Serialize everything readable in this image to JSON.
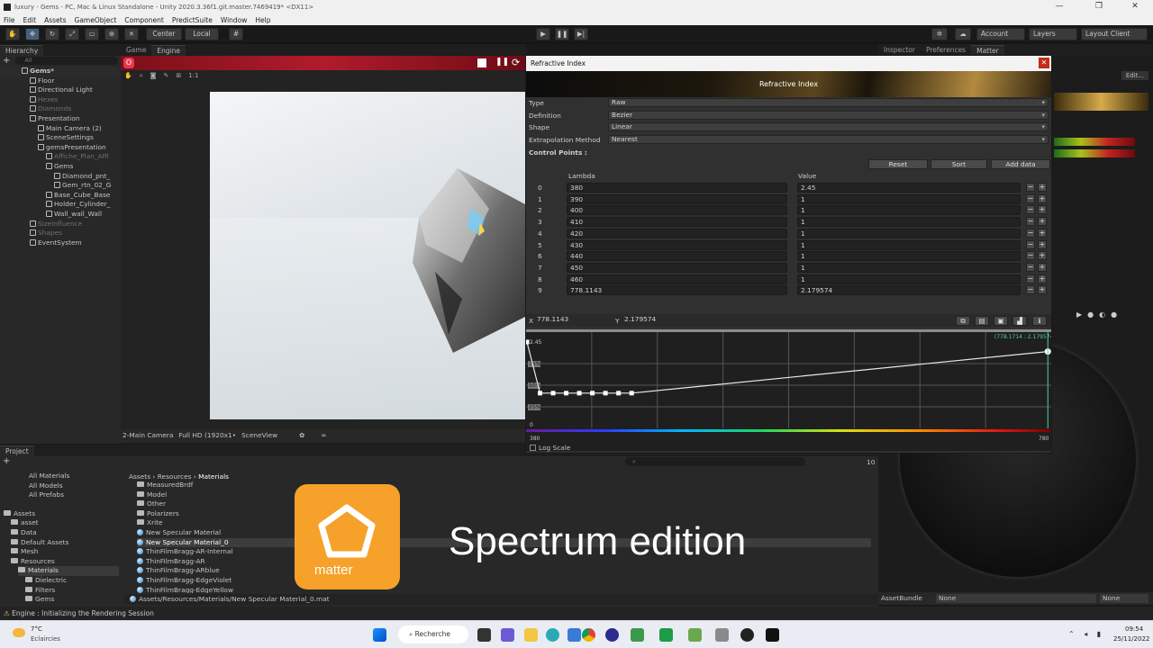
{
  "window": {
    "title": "luxury - Gems - PC, Mac & Linux Standalone - Unity 2020.3.36f1.git.master.7469419* <DX11>"
  },
  "menu": [
    "File",
    "Edit",
    "Assets",
    "GameObject",
    "Component",
    "PredictSuite",
    "Window",
    "Help"
  ],
  "toolbar": {
    "pivot": "Center",
    "space": "Local",
    "account": "Account",
    "layers": "Layers",
    "layout": "Layout Client"
  },
  "hierarchy": {
    "tab": "Hierarchy",
    "search_placeholder": "All",
    "items": [
      {
        "label": "Gems*",
        "indent": 0,
        "style": "scene"
      },
      {
        "label": "Floor",
        "indent": 1
      },
      {
        "label": "Directional Light",
        "indent": 1
      },
      {
        "label": "Hexes",
        "indent": 1,
        "style": "dim"
      },
      {
        "label": "Diamonds",
        "indent": 1,
        "style": "dim"
      },
      {
        "label": "Presentation",
        "indent": 1
      },
      {
        "label": "Main Camera (2)",
        "indent": 2
      },
      {
        "label": "SceneSettings",
        "indent": 2
      },
      {
        "label": "gemsPresentation",
        "indent": 2
      },
      {
        "label": "Affiche_Plan_Affi",
        "indent": 3,
        "style": "dim"
      },
      {
        "label": "Gems",
        "indent": 3
      },
      {
        "label": "Diamond_pnt_",
        "indent": 4
      },
      {
        "label": "Gem_rtn_02_G",
        "indent": 4
      },
      {
        "label": "Base_Cube_Base",
        "indent": 3
      },
      {
        "label": "Holder_Cylinder_",
        "indent": 3
      },
      {
        "label": "Wall_wall_Wall",
        "indent": 3
      },
      {
        "label": "SizeInfluence",
        "indent": 1,
        "style": "dim"
      },
      {
        "label": "Shapes",
        "indent": 1,
        "style": "dim"
      },
      {
        "label": "EventSystem",
        "indent": 1
      }
    ]
  },
  "game": {
    "tabs": [
      "Game",
      "Engine"
    ],
    "display": "2-Main Camera",
    "resolution": "Full HD (1920x1•",
    "view": "SceneView",
    "scale_label": "1:1"
  },
  "inspector_tabs": [
    "Inspector",
    "Preferences",
    "Matter"
  ],
  "inspector_buttons": [
    "Edit..."
  ],
  "dialog": {
    "title": "Refractive Index",
    "banner": "Refractive Index",
    "properties": [
      {
        "label": "Type",
        "value": "Raw"
      },
      {
        "label": "Definition",
        "value": "Bezier"
      },
      {
        "label": "Shape",
        "value": "Linear"
      },
      {
        "label": "Extrapolation Method",
        "value": "Nearest"
      }
    ],
    "control_points_label": "Control Points :",
    "buttons": [
      "Reset",
      "Sort",
      "Add data"
    ],
    "col_lambda": "Lambda",
    "col_value": "Value",
    "rows": [
      [
        "0",
        "380",
        "2.45"
      ],
      [
        "1",
        "390",
        "1"
      ],
      [
        "2",
        "400",
        "1"
      ],
      [
        "3",
        "410",
        "1"
      ],
      [
        "4",
        "420",
        "1"
      ],
      [
        "5",
        "430",
        "1"
      ],
      [
        "6",
        "440",
        "1"
      ],
      [
        "7",
        "450",
        "1"
      ],
      [
        "8",
        "460",
        "1"
      ],
      [
        "9",
        "778.1143",
        "2.179574"
      ]
    ],
    "cursor": {
      "x_label": "X",
      "x": "778.1143",
      "y_label": "Y",
      "y": "2.179574"
    },
    "graph": {
      "y_max_label": "2.45",
      "y_min_label": "0",
      "x_min": "380",
      "x_max": "780",
      "point_label": "(778.1714 : 2.179574)",
      "pct_labels": [
        "75%",
        "50%",
        "25%"
      ]
    },
    "log_scale": "Log Scale"
  },
  "project": {
    "tab": "Project",
    "favorites": [
      "All Materials",
      "All Models",
      "All Prefabs"
    ],
    "assets_root": "Assets",
    "tree": [
      "asset",
      "Data",
      "Default Assets",
      "Mesh",
      "Resources",
      "Materials",
      "Dielectric",
      "Filters",
      "Gems"
    ],
    "breadcrumb": [
      "Assets",
      "Resources",
      "Materials"
    ],
    "files": [
      {
        "label": "MeasuredBrdf",
        "kind": "folder"
      },
      {
        "label": "Model",
        "kind": "folder"
      },
      {
        "label": "Other",
        "kind": "folder"
      },
      {
        "label": "Polarizers",
        "kind": "folder"
      },
      {
        "label": "Xrite",
        "kind": "folder"
      },
      {
        "label": "New Specular Material",
        "kind": "mat"
      },
      {
        "label": "New Specular Material_0",
        "kind": "mat",
        "selected": true
      },
      {
        "label": "ThinFilmBragg-AR-Internal",
        "kind": "mat"
      },
      {
        "label": "ThinFilmBragg-AR",
        "kind": "mat"
      },
      {
        "label": "ThinFilmBragg-ARblue",
        "kind": "mat"
      },
      {
        "label": "ThinFilmBragg-EdgeViolet",
        "kind": "mat"
      },
      {
        "label": "ThinFilmBragg-EdgeYellow",
        "kind": "mat"
      }
    ],
    "path": "Assets/Resources/Materials/New Specular Material_0.mat",
    "count": "10"
  },
  "overlay": {
    "title": "Spectrum edition",
    "logo_text": "matter"
  },
  "asset_bundle": {
    "label": "AssetBundle",
    "value": "None",
    "variant": "None"
  },
  "status": "Engine : Initializing the Rendering Session",
  "taskbar": {
    "weather_temp": "7°C",
    "weather_desc": "Eclaircies",
    "search": "Recherche",
    "time": "09:54",
    "date": "25/11/2022"
  }
}
